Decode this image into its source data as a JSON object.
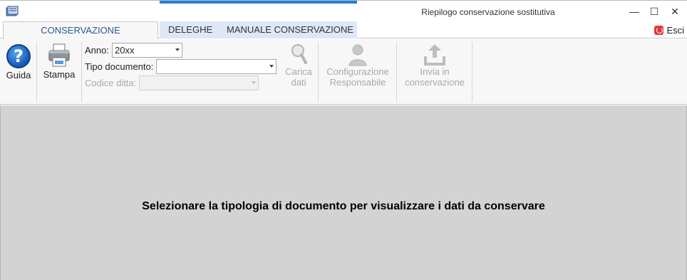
{
  "window": {
    "title": "Riepilogo conservazione sostitutiva",
    "controls": {
      "minimize": "—",
      "maximize": "☐",
      "close": "✕"
    }
  },
  "tabs": [
    {
      "label": "CONSERVAZIONE SOSTITUTIVA",
      "active": true
    },
    {
      "label": "DELEGHE",
      "active": false
    },
    {
      "label": "MANUALE CONSERVAZIONE",
      "active": false
    }
  ],
  "exit": {
    "label": "Esci",
    "icon": "power-icon"
  },
  "ribbon": {
    "help": {
      "label": "Guida",
      "icon": "help-icon"
    },
    "print": {
      "label": "Stampa",
      "icon": "printer-icon"
    },
    "fields": {
      "year": {
        "label": "Anno:",
        "value": "20xx"
      },
      "doc_type": {
        "label": "Tipo documento:",
        "value": ""
      },
      "company_code": {
        "label": "Codice ditta:",
        "value": "",
        "disabled": true
      }
    },
    "load": {
      "label_1": "Carica",
      "label_2": "dati",
      "icon": "magnifier-icon",
      "disabled": true
    },
    "config": {
      "label_1": "Configurazione",
      "label_2": "Responsabile",
      "icon": "user-icon",
      "disabled": true
    },
    "send": {
      "label_1": "Invia in",
      "label_2": "conservazione",
      "icon": "upload-icon",
      "disabled": true
    }
  },
  "main": {
    "message": "Selezionare la tipologia di documento per visualizzare i dati da conservare"
  },
  "colors": {
    "accent": "#2b7cd3",
    "active_tab_text": "#2b5797",
    "main_bg": "#d3d3d3",
    "disabled_text": "#a8a8a8"
  }
}
